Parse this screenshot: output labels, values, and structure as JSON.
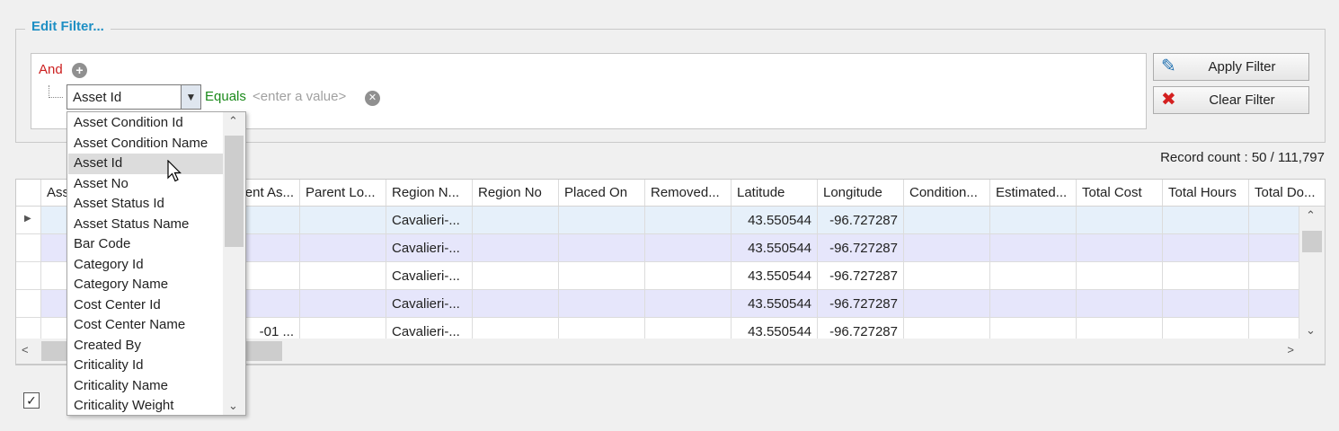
{
  "filter": {
    "title": "Edit Filter...",
    "group_operator": "And",
    "field_value": "Asset Id",
    "operator": "Equals",
    "value_placeholder": "<enter a value>",
    "apply_label": "Apply Filter",
    "clear_label": "Clear Filter",
    "colors": {
      "title": "#1e8fc4",
      "group": "#cc1f1f",
      "operator": "#1b8a1b"
    }
  },
  "record_count": "Record count : 50 / 111,797",
  "grid": {
    "columns": [
      "Ass",
      "ent As...",
      "Parent Lo...",
      "Region N...",
      "Region No",
      "Placed On",
      "Removed...",
      "Latitude",
      "Longitude",
      "Condition...",
      "Estimated...",
      "Total Cost",
      "Total Hours",
      "Total Do..."
    ],
    "rows": [
      {
        "c1": "",
        "region": "Cavalieri-...",
        "lat": "43.550544",
        "lon": "-96.727287"
      },
      {
        "c1": "",
        "region": "Cavalieri-...",
        "lat": "43.550544",
        "lon": "-96.727287"
      },
      {
        "c1": "",
        "region": "Cavalieri-...",
        "lat": "43.550544",
        "lon": "-96.727287"
      },
      {
        "c1": "",
        "region": "Cavalieri-...",
        "lat": "43.550544",
        "lon": "-96.727287"
      },
      {
        "c1": "-01 ...",
        "region": "Cavalieri-...",
        "lat": "43.550544",
        "lon": "-96.727287"
      }
    ]
  },
  "dropdown": {
    "items": [
      "Asset Condition Id",
      "Asset Condition Name",
      "Asset Id",
      "Asset No",
      "Asset Status Id",
      "Asset Status Name",
      "Bar Code",
      "Category Id",
      "Category Name",
      "Cost Center Id",
      "Cost Center Name",
      "Created By",
      "Criticality Id",
      "Criticality Name",
      "Criticality Weight"
    ],
    "hover_item": "Asset Id"
  },
  "icons": {
    "plus": "plus-circle-icon",
    "remove": "close-circle-icon",
    "apply": "pencil-icon",
    "clear": "red-x-icon"
  }
}
